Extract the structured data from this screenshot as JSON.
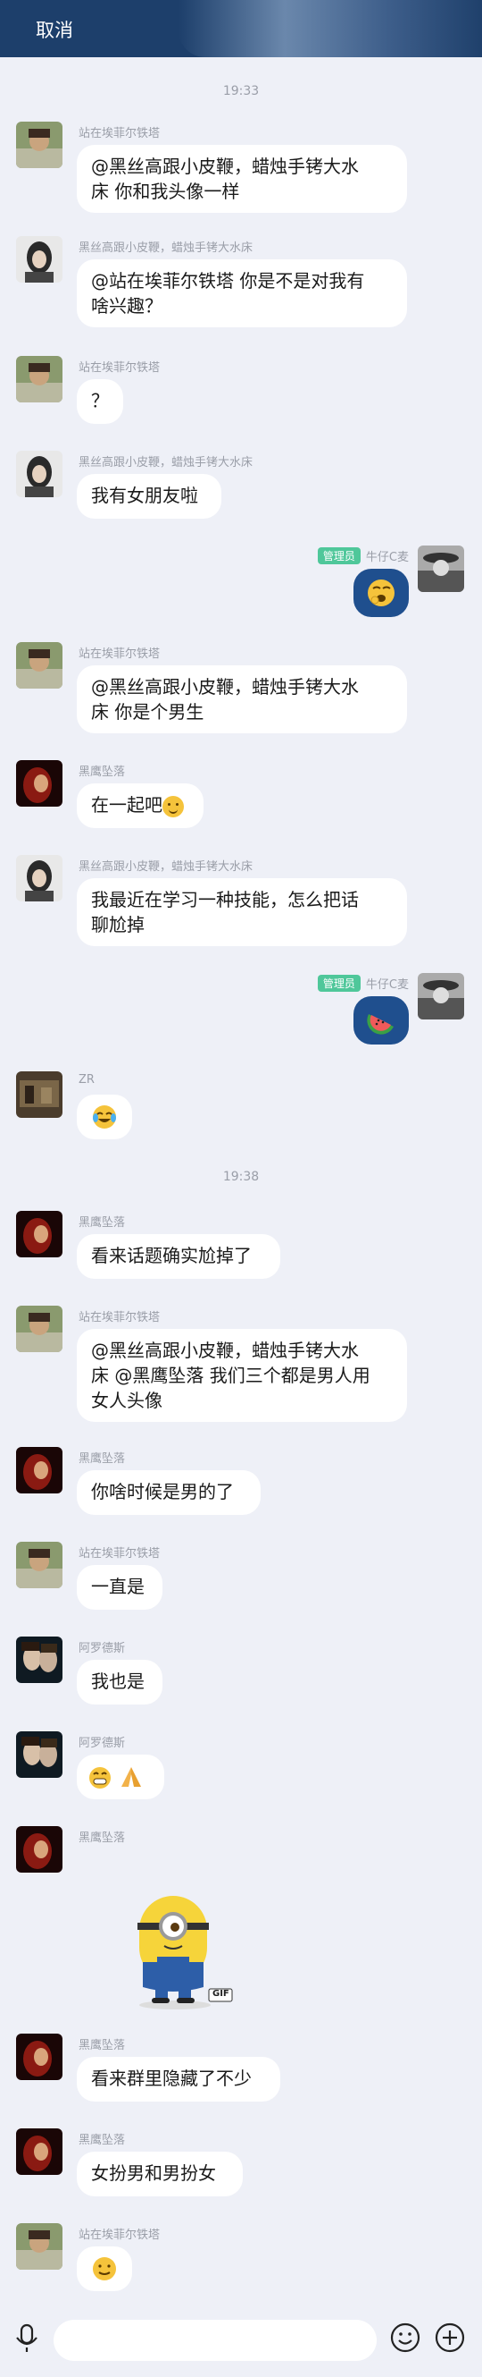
{
  "header": {
    "cancel": "取消"
  },
  "times": [
    "19:33",
    "19:38"
  ],
  "names": {
    "a": "站在埃菲尔铁塔",
    "b": "黑丝高跟小皮鞭，蜡烛手铐大水床",
    "c": "黑鹰坠落",
    "d": "ZR",
    "e": "阿罗德斯",
    "me": "牛仔C麦",
    "admin": "管理员"
  },
  "messages": {
    "m1": "@黑丝高跟小皮鞭，蜡烛手铐大水",
    "m1b": "床 你和我头像一样",
    "m2": "@站在埃菲尔铁塔 你是不是对我有",
    "m2b": "啥兴趣？",
    "m3": "？",
    "m4": "我有女朋友啦",
    "m5": "@黑丝高跟小皮鞭，蜡烛手铐大水",
    "m5b": "床 你是个男生",
    "m6": "在一起吧",
    "m7": "我最近在学习一种技能，怎么把话",
    "m7b": "聊尬掉",
    "m8": "看来话题确实尬掉了",
    "m9": "@黑丝高跟小皮鞭，蜡烛手铐大水",
    "m9b": "床 @黑鹰坠落 我们三个都是男人用",
    "m9c": "女人头像",
    "m10": "你啥时候是男的了",
    "m11": "一直是",
    "m12": "我也是",
    "m13": "看来群里隐藏了不少",
    "m14": "女扮男和男扮女"
  },
  "gif_label": "GIF"
}
